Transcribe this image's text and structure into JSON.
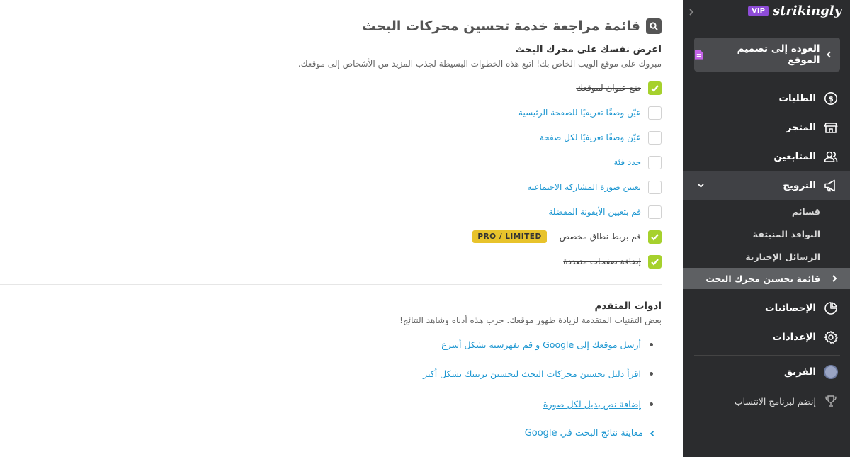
{
  "main": {
    "title": "قائمة مراجعة خدمة تحسين محركات البحث",
    "title_icon": "search-document-icon",
    "section1": {
      "heading": "اعرض نفسك على محرك البحث",
      "description": "مبروك على موقع الويب الخاص بك! اتبع هذه الخطوات البسيطة لجذب المزيد من الأشخاص إلى موقعك."
    },
    "checklist": [
      {
        "label": "ضع عنوان لموقعك",
        "checked": true
      },
      {
        "label": "عيّن وصفًا تعريفيًا للصفحة الرئيسية",
        "checked": false
      },
      {
        "label": "عيّن وصفًا تعريفيًا لكل صفحة",
        "checked": false
      },
      {
        "label": "حدد فئة",
        "checked": false
      },
      {
        "label": "تعيين صورة المشاركة الاجتماعية",
        "checked": false
      },
      {
        "label": "قم بتعيين الأيقونة المفضلة",
        "checked": false
      },
      {
        "label": "قم بربط نطاق مخصص",
        "checked": true,
        "badge": "PRO / LIMITED"
      },
      {
        "label": "إضافة صفحات متعددة",
        "checked": true
      }
    ],
    "section2": {
      "heading": "ادوات المتقدم",
      "description": "بعض التقنيات المتقدمة لزيادة ظهور موقعك. جرب هذه أدناه وشاهد النتائج!"
    },
    "advanced_links": [
      "أرسل موقعك إلى Google و قم بفهرسته بشكل أسرع",
      "اقرأ دليل تحسين محركات البحث لتحسين ترتيبك بشكل أكبر",
      "إضافة نص بديل لكل صورة"
    ],
    "preview_link": "معاينة نتائج البحث في Google"
  },
  "sidebar": {
    "brand": "strikingly",
    "vip_badge": "VIP",
    "back_button": "العودة إلى تصميم الموقع",
    "nav": [
      {
        "label": "الطلبات",
        "icon": "dollar-icon"
      },
      {
        "label": "المتجر",
        "icon": "store-icon"
      },
      {
        "label": "المتابعين",
        "icon": "users-icon"
      },
      {
        "label": "الترويج",
        "icon": "megaphone-icon"
      }
    ],
    "promo_sub": [
      "قسائم",
      "النوافذ المنبثقة",
      "الرسائل الإخبارية",
      "قائمة تحسين محرك البحث"
    ],
    "nav_bottom": [
      {
        "label": "الإحصائيات",
        "icon": "pie-chart-icon"
      },
      {
        "label": "الإعدادات",
        "icon": "gear-icon"
      }
    ],
    "team": "الفريق",
    "affiliate": "إنضم لبرنامج الانتساب"
  },
  "colors": {
    "accent": "#1e97d1",
    "check": "#a6d12d",
    "badge": "#e8c32b",
    "sidebar_bg": "#2b2c2e",
    "vip": "#8e4cd8"
  }
}
